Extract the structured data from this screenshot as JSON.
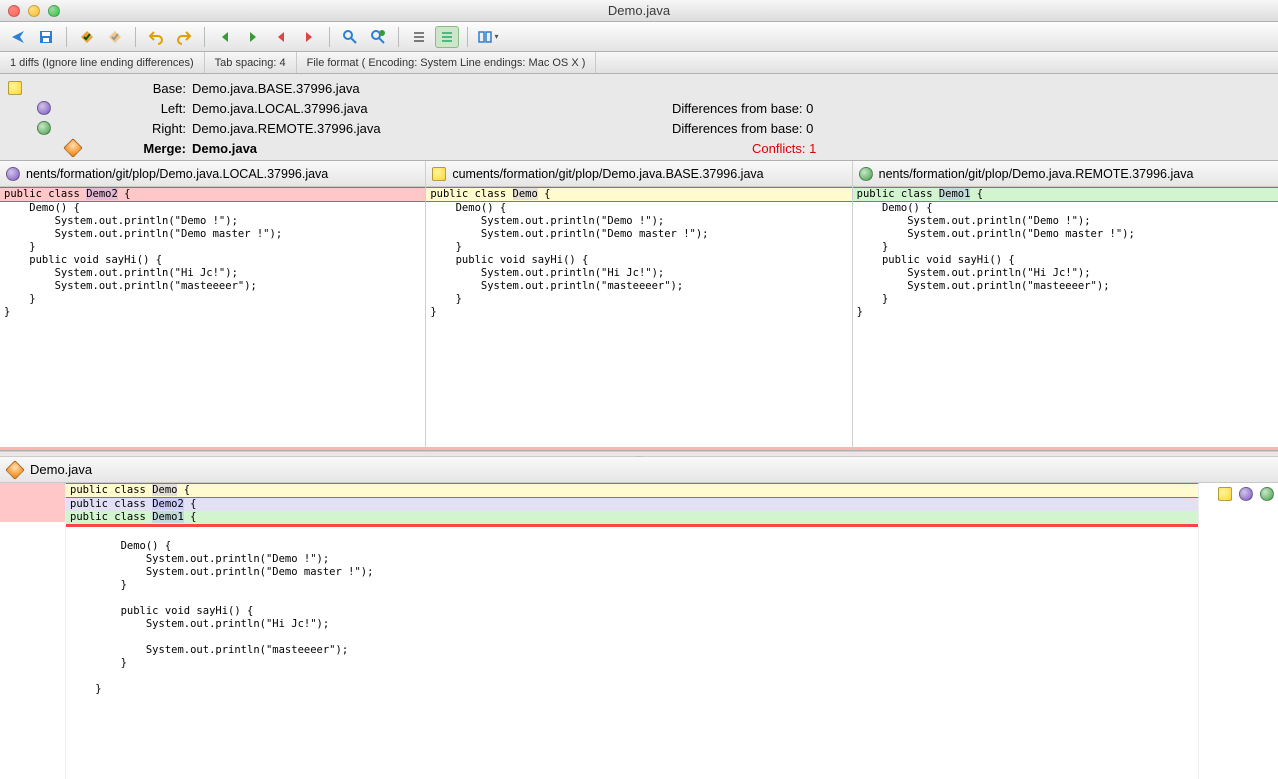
{
  "window": {
    "title": "Demo.java"
  },
  "status": {
    "diffs": "1 diffs (Ignore line ending differences)",
    "tabspacing": "Tab spacing: 4",
    "fileformat": "File format ( Encoding: System  Line endings: Mac OS X )"
  },
  "header": {
    "base": {
      "label": "Base:",
      "file": "Demo.java.BASE.37996.java"
    },
    "left": {
      "label": "Left:",
      "file": "Demo.java.LOCAL.37996.java",
      "diff": "Differences from base: 0"
    },
    "right": {
      "label": "Right:",
      "file": "Demo.java.REMOTE.37996.java",
      "diff": "Differences from base: 0"
    },
    "merge": {
      "label": "Merge:",
      "file": "Demo.java",
      "conflicts": "Conflicts: 1"
    }
  },
  "panes": {
    "left": {
      "path": "nents/formation/git/plop/Demo.java.LOCAL.37996.java",
      "first": "public class Demo2 {",
      "token": "Demo2",
      "hlclass": "hl-red"
    },
    "base": {
      "path": "cuments/formation/git/plop/Demo.java.BASE.37996.java",
      "first": "public class Demo {",
      "token": "Demo",
      "hlclass": "hl-yellow"
    },
    "right": {
      "path": "nents/formation/git/plop/Demo.java.REMOTE.37996.java",
      "first": "public class Demo1 {",
      "token": "Demo1",
      "hlclass": "hl-green"
    },
    "body": [
      "",
      "    Demo() {",
      "        System.out.println(\"Demo !\");",
      "        System.out.println(\"Demo master !\");",
      "    }",
      "",
      "    public void sayHi() {",
      "        System.out.println(\"Hi Jc!\");",
      "",
      "        System.out.println(\"masteeeer\");",
      "    }",
      "",
      "}"
    ]
  },
  "merge": {
    "title": "Demo.java",
    "conflict": {
      "base": {
        "text": "public class Demo {",
        "token": "Demo"
      },
      "left": {
        "text": "public class Demo2 {",
        "token": "Demo2"
      },
      "right": {
        "text": "public class Demo1 {",
        "token": "Demo1"
      }
    },
    "body": [
      "",
      "    Demo() {",
      "        System.out.println(\"Demo !\");",
      "        System.out.println(\"Demo master !\");",
      "    }",
      "",
      "    public void sayHi() {",
      "        System.out.println(\"Hi Jc!\");",
      "",
      "        System.out.println(\"masteeeer\");",
      "    }",
      "",
      "}"
    ]
  }
}
